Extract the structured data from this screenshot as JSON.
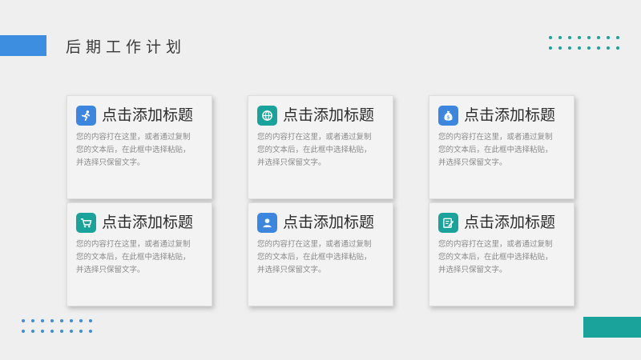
{
  "title": "后期工作计划",
  "colors": {
    "blue": "#3d8de0",
    "teal": "#1aa39a",
    "background": "#efefef"
  },
  "cards": [
    {
      "icon": "running-person-icon",
      "title": "点击添加标题",
      "lines": [
        "您的内容打在这里，或者通过复制",
        "您的文本后，在此框中选择粘贴，",
        "并选择只保留文字。"
      ]
    },
    {
      "icon": "globe-icon",
      "title": "点击添加标题",
      "lines": [
        "您的内容打在这里，或者通过复制",
        "您的文本后，在此框中选择粘贴，",
        "并选择只保留文字。"
      ]
    },
    {
      "icon": "money-bag-icon",
      "title": "点击添加标题",
      "lines": [
        "您的内容打在这里，或者通过复制",
        "您的文本后，在此框中选择粘贴，",
        "并选择只保留文字。"
      ]
    },
    {
      "icon": "shopping-cart-icon",
      "title": "点击添加标题",
      "lines": [
        "您的内容打在这里，或者通过复制",
        "您的文本后，在此框中选择粘贴，",
        "并选择只保留文字。"
      ]
    },
    {
      "icon": "user-icon",
      "title": "点击添加标题",
      "lines": [
        "您的内容打在这里，或者通过复制",
        "您的文本后，在此框中选择粘贴，",
        "并选择只保留文字。"
      ]
    },
    {
      "icon": "edit-note-icon",
      "title": "点击添加标题",
      "lines": [
        "您的内容打在这里，或者通过复制",
        "您的文本后，在此框中选择粘贴，",
        "并选择只保留文字。"
      ]
    }
  ]
}
